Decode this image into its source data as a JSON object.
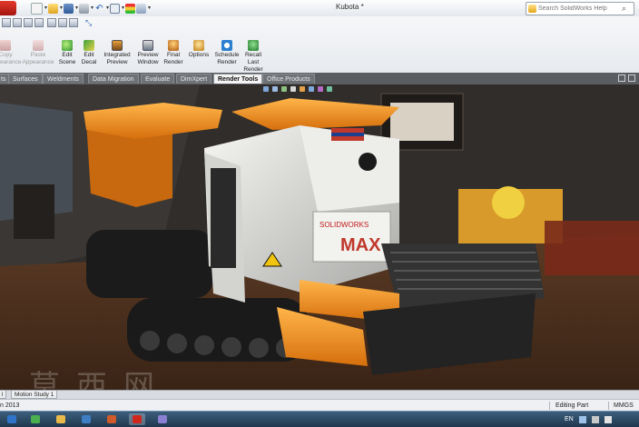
{
  "window": {
    "title": "Kubota *"
  },
  "search": {
    "placeholder": "Search SolidWorks Help"
  },
  "ribbon": {
    "commands": [
      {
        "label": "Copy\nAppearance",
        "icon": "copy-appearance-icon",
        "enabled": false
      },
      {
        "label": "Paste\nAppearance",
        "icon": "paste-appearance-icon",
        "enabled": false
      },
      {
        "label": "Edit\nScene",
        "icon": "edit-scene-icon",
        "enabled": true
      },
      {
        "label": "Edit\nDecal",
        "icon": "edit-decal-icon",
        "enabled": true
      },
      {
        "label": "Integrated\nPreview",
        "icon": "integrated-preview-icon",
        "enabled": true
      },
      {
        "label": "Preview\nWindow",
        "icon": "preview-window-icon",
        "enabled": true
      },
      {
        "label": "Final\nRender",
        "icon": "final-render-icon",
        "enabled": true
      },
      {
        "label": "Options",
        "icon": "options-icon",
        "enabled": true
      },
      {
        "label": "Schedule\nRender",
        "icon": "schedule-render-icon",
        "enabled": true
      },
      {
        "label": "Recall\nLast\nRender",
        "icon": "recall-last-render-icon",
        "enabled": true
      }
    ]
  },
  "tabs": [
    {
      "label": "ts",
      "active": false
    },
    {
      "label": "Surfaces",
      "active": false
    },
    {
      "label": "Weldments",
      "active": false
    },
    {
      "label": "Data Migration",
      "active": false
    },
    {
      "label": "Evaluate",
      "active": false
    },
    {
      "label": "DimXpert",
      "active": false
    },
    {
      "label": "Render Tools",
      "active": true
    },
    {
      "label": "Office Products",
      "active": false
    }
  ],
  "decals": {
    "logo": "SOLIDWORKS",
    "model": "MAX"
  },
  "watermark": "莫西网",
  "model_tabs": [
    {
      "label": "l"
    },
    {
      "label": "Motion Study 1"
    }
  ],
  "status": {
    "left": "n 2013",
    "mode": "Editing Part",
    "units": "MMGS"
  },
  "tray": {
    "lang": "EN"
  },
  "colors": {
    "ribbon_bg": "#eef0f3",
    "active_tab": "#f3f3f3",
    "machine_orange": "#f0901c",
    "machine_body": "#e9e9e6"
  }
}
